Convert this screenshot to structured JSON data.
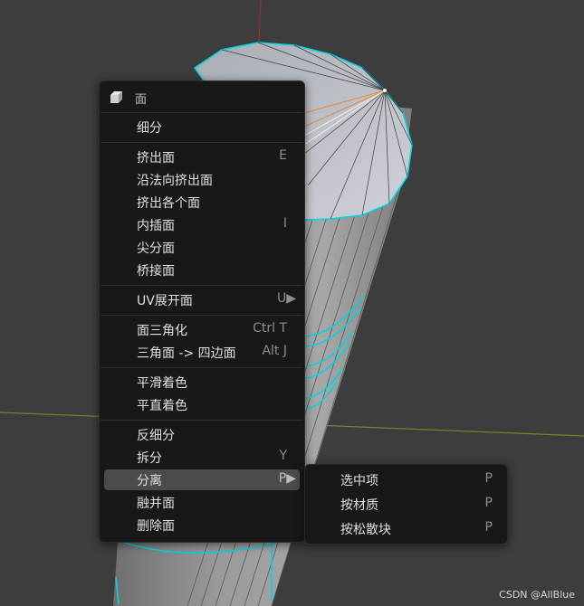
{
  "menu": {
    "title": "面",
    "items": [
      {
        "label": "细分",
        "shortcut": ""
      },
      {
        "label": "挤出面",
        "shortcut": "E"
      },
      {
        "label": "沿法向挤出面",
        "shortcut": ""
      },
      {
        "label": "挤出各个面",
        "shortcut": ""
      },
      {
        "label": "内插面",
        "shortcut": "I"
      },
      {
        "label": "尖分面",
        "shortcut": ""
      },
      {
        "label": "桥接面",
        "shortcut": ""
      },
      {
        "label": "UV展开面",
        "shortcut": "U▶"
      },
      {
        "label": "面三角化",
        "shortcut": "Ctrl T"
      },
      {
        "label": "三角面 -> 四边面",
        "shortcut": "Alt J"
      },
      {
        "label": "平滑着色",
        "shortcut": ""
      },
      {
        "label": "平直着色",
        "shortcut": ""
      },
      {
        "label": "反细分",
        "shortcut": ""
      },
      {
        "label": "拆分",
        "shortcut": "Y"
      },
      {
        "label": "分离",
        "shortcut": "P▶"
      },
      {
        "label": "融并面",
        "shortcut": ""
      },
      {
        "label": "删除面",
        "shortcut": ""
      }
    ]
  },
  "submenu": {
    "items": [
      {
        "label": "选中项",
        "shortcut": "P"
      },
      {
        "label": "按材质",
        "shortcut": "P"
      },
      {
        "label": "按松散块",
        "shortcut": "P"
      }
    ]
  },
  "watermark": "CSDN @AllBlue",
  "colors": {
    "viewport_bg": "#3d3d3d",
    "menu_bg": "#181818",
    "highlight": "#4b4b4b",
    "edge_select": "#00d5e0",
    "mesh_face": "#8f8f8f"
  }
}
